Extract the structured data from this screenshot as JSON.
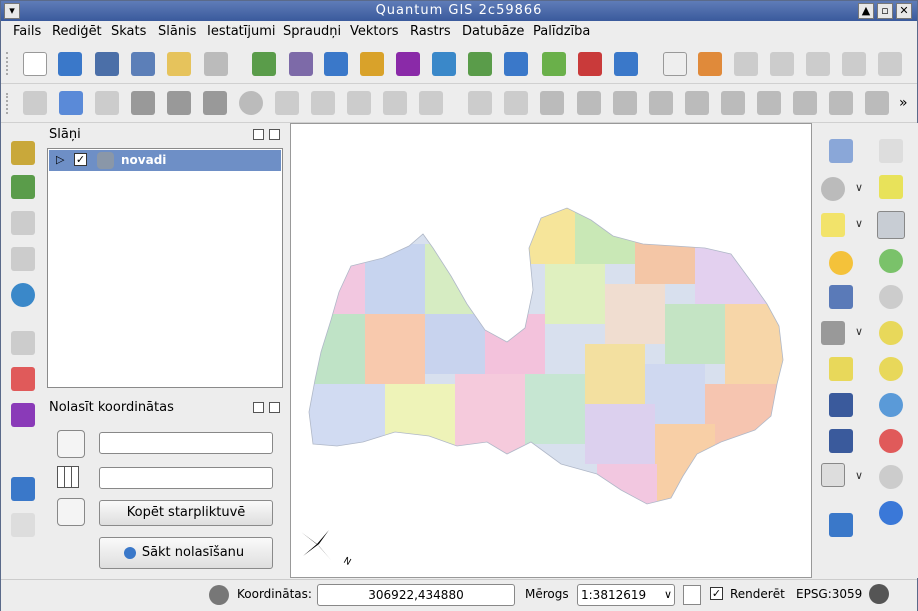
{
  "window": {
    "title": "Quantum GIS 2c59866",
    "min_label": "▲",
    "max_label": "▫",
    "close_label": "✕",
    "menu_label": "▾"
  },
  "menu": [
    "Fails",
    "Rediģēt",
    "Skats",
    "Slānis",
    "Iestatījumi",
    "Spraudņi",
    "Vektors",
    "Rastrs",
    "Datubāze",
    "Palīdzība"
  ],
  "layers_panel": {
    "title": "Slāņi",
    "layer": {
      "name": "novadi",
      "checked": true
    }
  },
  "coord_panel": {
    "title": "Nolasīt koordinātas",
    "field1_value": "",
    "field2_value": "",
    "copy_button": "Kopēt starpliktuvē",
    "start_button": "Sākt nolasīšanu"
  },
  "overflow_glyph": "»",
  "north_arrow_label": "N",
  "status": {
    "coord_label": "Koordinātas:",
    "coord_value": "306922,434880",
    "scale_label": "Mērogs",
    "scale_value": "1:3812619",
    "render_label": "Renderēt",
    "render_checked": true,
    "crs": "EPSG:3059"
  },
  "colors": {
    "accent": "#6e8fc6",
    "titlebar": "#3a5a9c"
  }
}
